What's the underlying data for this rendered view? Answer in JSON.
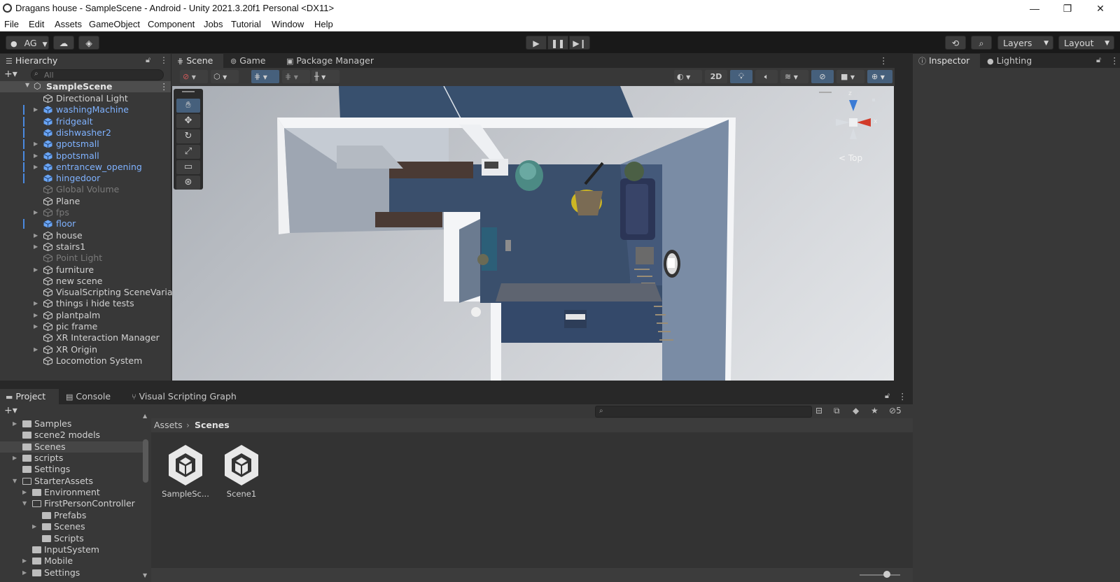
{
  "window": {
    "title": "Dragans house - SampleScene - Android - Unity 2021.3.20f1 Personal <DX11>",
    "minimize": "—",
    "maximize": "❐",
    "close": "✕"
  },
  "menu": [
    "File",
    "Edit",
    "Assets",
    "GameObject",
    "Component",
    "Jobs",
    "Tutorial",
    "Window",
    "Help"
  ],
  "toolbar": {
    "account": "AG",
    "layers": "Layers",
    "layout": "Layout"
  },
  "hierarchy": {
    "tab": "Hierarchy",
    "search_placeholder": "All",
    "scene": "SampleScene",
    "items": [
      {
        "label": "Directional Light",
        "style": "normal",
        "expandable": false
      },
      {
        "label": "washingMachine",
        "style": "blue",
        "expandable": true
      },
      {
        "label": "fridgealt",
        "style": "blue",
        "expandable": false
      },
      {
        "label": "dishwasher2",
        "style": "blue",
        "expandable": false
      },
      {
        "label": "gpotsmall",
        "style": "blue",
        "expandable": true
      },
      {
        "label": "bpotsmall",
        "style": "blue",
        "expandable": true
      },
      {
        "label": "entrancew_opening",
        "style": "blue",
        "expandable": true
      },
      {
        "label": "hingedoor",
        "style": "blue",
        "expandable": false
      },
      {
        "label": "Global Volume",
        "style": "dim",
        "expandable": false
      },
      {
        "label": "Plane",
        "style": "normal",
        "expandable": false
      },
      {
        "label": "fps",
        "style": "dim",
        "expandable": true
      },
      {
        "label": "floor",
        "style": "blue",
        "expandable": false
      },
      {
        "label": "house",
        "style": "normal",
        "expandable": true
      },
      {
        "label": "stairs1",
        "style": "normal",
        "expandable": true
      },
      {
        "label": "Point Light",
        "style": "dim",
        "expandable": false
      },
      {
        "label": "furniture",
        "style": "normal",
        "expandable": true
      },
      {
        "label": "new scene",
        "style": "normal",
        "expandable": false
      },
      {
        "label": "VisualScripting SceneVaria",
        "style": "normal",
        "expandable": false
      },
      {
        "label": "things i hide tests",
        "style": "normal",
        "expandable": true
      },
      {
        "label": "plantpalm",
        "style": "normal",
        "expandable": true
      },
      {
        "label": "pic frame",
        "style": "normal",
        "expandable": true
      },
      {
        "label": "XR Interaction Manager",
        "style": "normal",
        "expandable": false
      },
      {
        "label": "XR Origin",
        "style": "normal",
        "expandable": true
      },
      {
        "label": "Locomotion System",
        "style": "normal",
        "expandable": false
      }
    ]
  },
  "center_tabs": {
    "scene": "Scene",
    "game": "Game",
    "package_manager": "Package Manager"
  },
  "scene_toolbar": {
    "mode_2d": "2D"
  },
  "gizmo": {
    "view_label": "Top",
    "axis_z": "z",
    "axis_x": "x"
  },
  "right_tabs": {
    "inspector": "Inspector",
    "lighting": "Lighting"
  },
  "bottom_tabs": {
    "project": "Project",
    "console": "Console",
    "visual_scripting": "Visual Scripting Graph"
  },
  "project": {
    "hidden_count": "5",
    "breadcrumb": [
      "Assets",
      "Scenes"
    ],
    "tree": [
      {
        "label": "Samples",
        "indent": 0,
        "arrow": "▶",
        "open": false,
        "selected": false
      },
      {
        "label": "scene2 models",
        "indent": 0,
        "arrow": "",
        "open": false,
        "selected": false
      },
      {
        "label": "Scenes",
        "indent": 0,
        "arrow": "",
        "open": false,
        "selected": true
      },
      {
        "label": "scripts",
        "indent": 0,
        "arrow": "▶",
        "open": false,
        "selected": false
      },
      {
        "label": "Settings",
        "indent": 0,
        "arrow": "",
        "open": false,
        "selected": false
      },
      {
        "label": "StarterAssets",
        "indent": 0,
        "arrow": "▼",
        "open": true,
        "selected": false
      },
      {
        "label": "Environment",
        "indent": 1,
        "arrow": "▶",
        "open": false,
        "selected": false
      },
      {
        "label": "FirstPersonController",
        "indent": 1,
        "arrow": "▼",
        "open": true,
        "selected": false
      },
      {
        "label": "Prefabs",
        "indent": 2,
        "arrow": "",
        "open": false,
        "selected": false
      },
      {
        "label": "Scenes",
        "indent": 2,
        "arrow": "▶",
        "open": false,
        "selected": false
      },
      {
        "label": "Scripts",
        "indent": 2,
        "arrow": "",
        "open": false,
        "selected": false
      },
      {
        "label": "InputSystem",
        "indent": 1,
        "arrow": "",
        "open": false,
        "selected": false
      },
      {
        "label": "Mobile",
        "indent": 1,
        "arrow": "▶",
        "open": false,
        "selected": false
      },
      {
        "label": "Settings",
        "indent": 1,
        "arrow": "▶",
        "open": false,
        "selected": false
      }
    ],
    "assets": [
      "SampleSc...",
      "Scene1"
    ]
  }
}
